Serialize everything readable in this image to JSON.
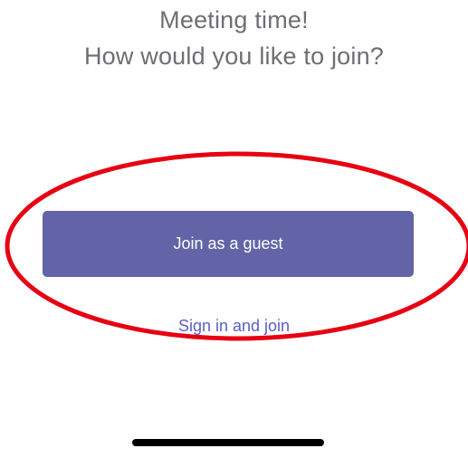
{
  "header": {
    "line1": "Meeting time!",
    "line2": "How would you like to join?"
  },
  "actions": {
    "guest_label": "Join as a guest",
    "signin_label": "Sign in and join"
  },
  "colors": {
    "accent": "#6264a7",
    "link": "#5b5fc7",
    "annotation": "#e60012"
  }
}
